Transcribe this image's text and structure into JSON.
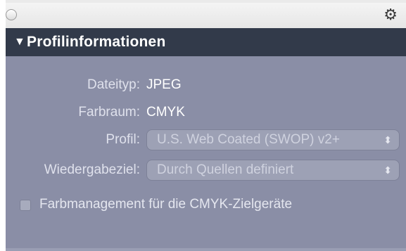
{
  "panel": {
    "gear_icon": "⚙",
    "section_title": "Profilinformationen",
    "disclosure_icon": "▼"
  },
  "fields": {
    "dateityp_label": "Dateityp:",
    "dateityp_value": "JPEG",
    "farbraum_label": "Farbraum:",
    "farbraum_value": "CMYK",
    "profil_label": "Profil:",
    "profil_value": "U.S. Web Coated (SWOP) v2+",
    "wiedergabeziel_label": "Wiedergabeziel:",
    "wiedergabeziel_value": "Durch Quellen definiert",
    "select_arrows": "⬍"
  },
  "options": {
    "farbmanagement_label": "Farbmanagement für die CMYK-Zielgeräte",
    "farbmanagement_checked": false
  }
}
